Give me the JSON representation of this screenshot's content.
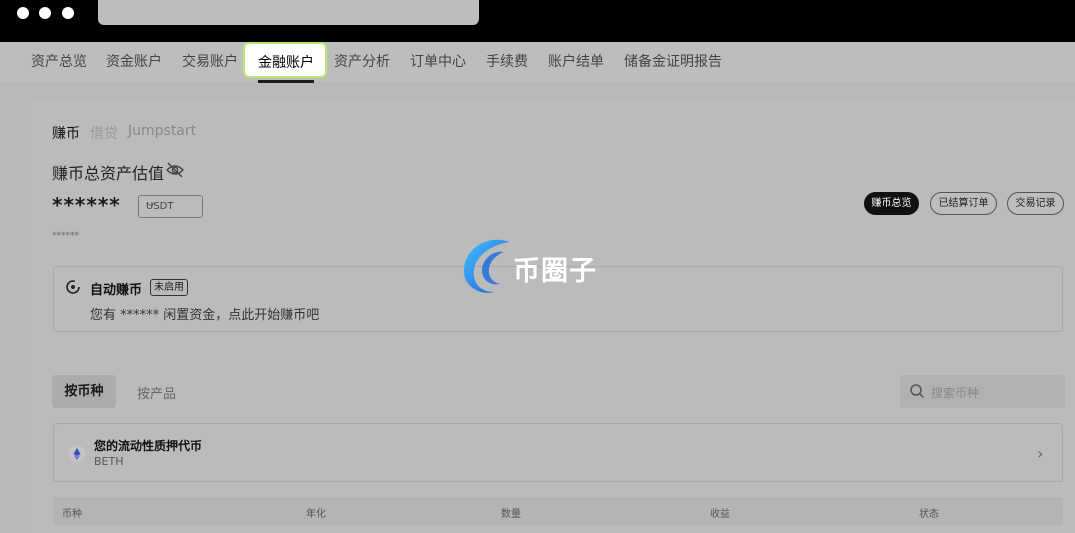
{
  "window": {
    "dots": [
      "window-dot",
      "window-dot",
      "window-dot"
    ]
  },
  "nav": {
    "items": [
      {
        "label": "资产总览"
      },
      {
        "label": "资金账户"
      },
      {
        "label": "交易账户"
      },
      {
        "label": "金融账户",
        "active": true
      },
      {
        "label": "资产分析"
      },
      {
        "label": "订单中心"
      },
      {
        "label": "手续费"
      },
      {
        "label": "账户结单"
      },
      {
        "label": "储备金证明报告"
      }
    ]
  },
  "subtabs": [
    {
      "label": "赚币",
      "active": true
    },
    {
      "label": "借贷"
    },
    {
      "label": "Jumpstart"
    }
  ],
  "summary": {
    "title": "赚币总资产估值",
    "eye_icon": "eye-off-icon",
    "value_masked": "******",
    "currency": "USDT",
    "sub_value_masked": "******"
  },
  "actions": {
    "overview": "赚币总览",
    "settled_orders": "已结算订单",
    "records": "交易记录"
  },
  "auto_earn": {
    "title": "自动赚币",
    "badge": "未启用",
    "description": "您有 ****** 闲置资金，点此开始赚币吧"
  },
  "filter": {
    "by_coin": "按币种",
    "by_product": "按产品",
    "search_placeholder": "搜索币种"
  },
  "promo": {
    "title": "您的流动性质押代币",
    "subtitle": "BETH"
  },
  "table": {
    "headers": [
      "币种",
      "年化",
      "数量",
      "收益",
      "状态"
    ]
  },
  "watermark": {
    "text": "币圈子"
  },
  "colors": {
    "active_tab_border": "#b8e870",
    "topbar": "#000000",
    "pill_dark": "#111111"
  }
}
